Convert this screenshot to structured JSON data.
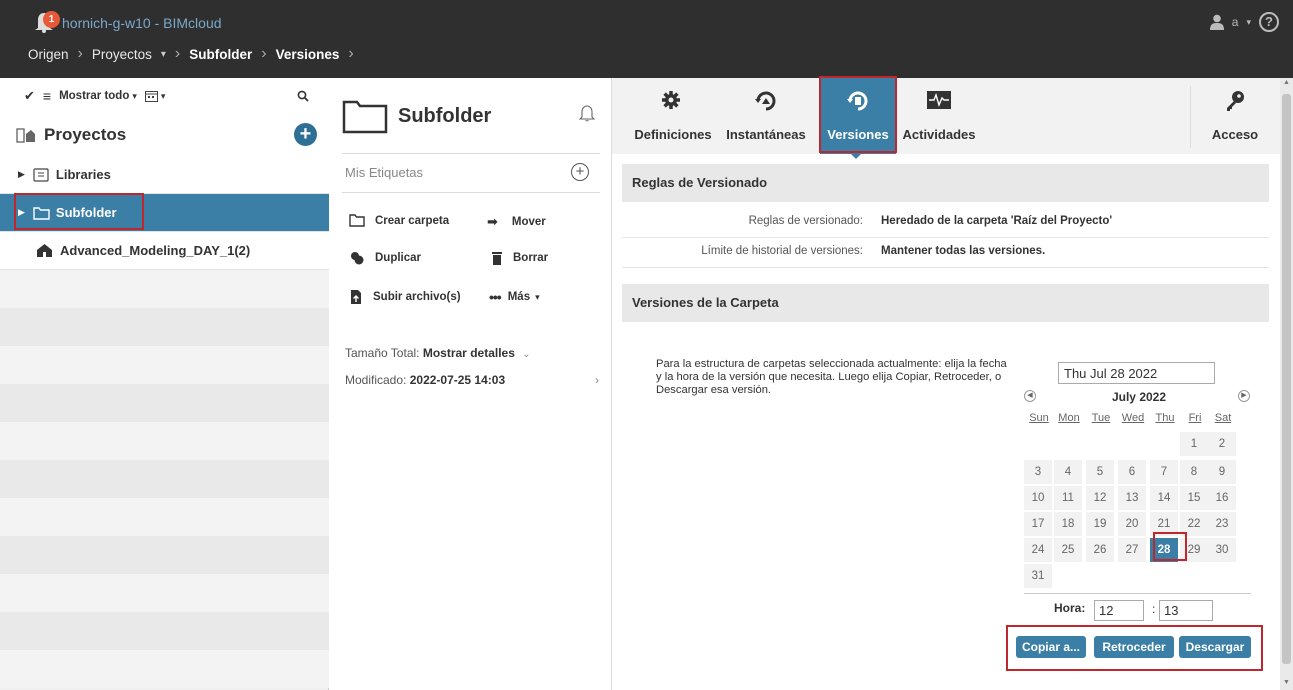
{
  "app": {
    "notification_count": "1",
    "title": "hornich-g-w10 - BIMcloud",
    "user_label": "a",
    "help_icon": "?"
  },
  "breadcrumb": {
    "items": [
      "Origen",
      "Proyectos",
      "Subfolder",
      "Versiones"
    ]
  },
  "left_panel": {
    "toolbar": {
      "filter_label": "Mostrar todo"
    },
    "header": "Proyectos",
    "tree": [
      {
        "label": "Libraries",
        "icon": "library-icon"
      },
      {
        "label": "Subfolder",
        "icon": "folder-icon",
        "selected": true
      },
      {
        "label": "Advanced_Modeling_DAY_1(2)",
        "icon": "project-icon"
      }
    ]
  },
  "middle_panel": {
    "folder_name": "Subfolder",
    "tags_label": "Mis Etiquetas",
    "actions": {
      "create_folder": "Crear carpeta",
      "move": "Mover",
      "duplicate": "Duplicar",
      "delete": "Borrar",
      "upload": "Subir archivo(s)",
      "more": "Más"
    },
    "total_size_label": "Tamaño Total:",
    "total_size_value": "Mostrar detalles",
    "modified_label": "Modificado:",
    "modified_value": "2022-07-25 14:03"
  },
  "tabs": {
    "definitions": "Definiciones",
    "snapshots": "Instantáneas",
    "versions": "Versiones",
    "activities": "Actividades",
    "access": "Acceso"
  },
  "versioning_rules": {
    "title": "Reglas de Versionado",
    "rules_label": "Reglas de versionado:",
    "rules_value": "Heredado de la carpeta 'Raíz del Proyecto'",
    "limit_label": "Límite de historial de versiones:",
    "limit_value": "Mantener todas las versiones."
  },
  "folder_versions": {
    "title": "Versiones de la Carpeta",
    "description": "Para la estructura de carpetas seleccionada actualmente: elija la fecha y la hora de la versión que necesita. Luego elija Copiar, Retroceder, o Descargar esa versión.",
    "date_value": "Thu Jul 28 2022",
    "calendar": {
      "month_label": "July 2022",
      "weekdays": [
        "Sun",
        "Mon",
        "Tue",
        "Wed",
        "Thu",
        "Fri",
        "Sat"
      ],
      "selected_day": "28"
    },
    "time_label": "Hora:",
    "hour": "12",
    "minute": "13",
    "buttons": {
      "copy": "Copiar a...",
      "revert": "Retroceder",
      "download": "Descargar"
    }
  },
  "colors": {
    "accent": "#3b7fa6",
    "topbar": "#2f2f2f",
    "highlight_box": "#c0272d"
  }
}
